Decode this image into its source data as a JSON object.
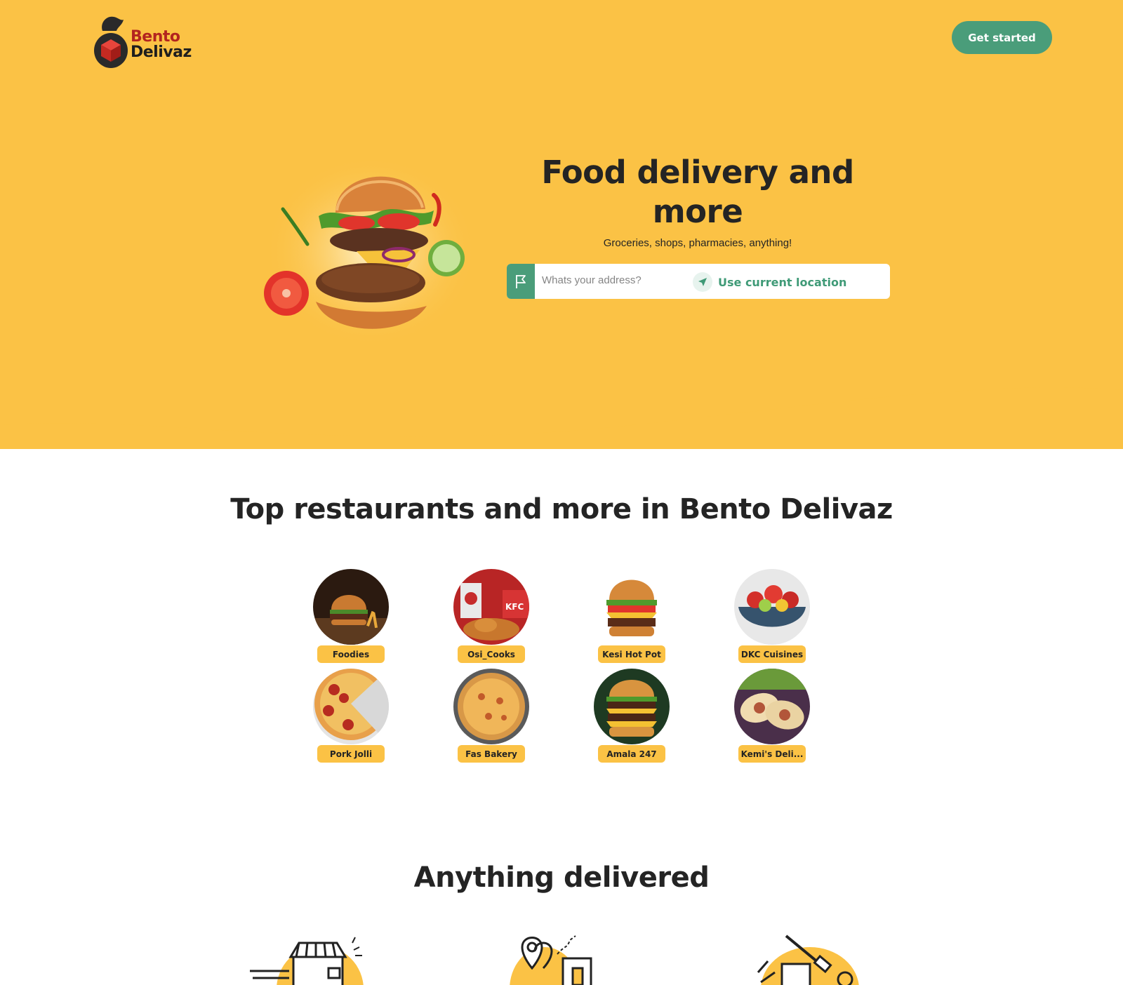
{
  "brand": {
    "name_line1": "Bento",
    "name_line2": "Delivaz",
    "accent_color": "#fbc245",
    "primary_color": "#4a9d7a",
    "brand_red": "#b3241f"
  },
  "header": {
    "cta_label": "Get started"
  },
  "hero": {
    "title": "Food delivery and more",
    "subtitle": "Groceries, shops, pharmacies, anything!",
    "address_placeholder": "Whats your address?",
    "use_location_label": "Use current location"
  },
  "restaurants": {
    "title": "Top restaurants and more in Bento Delivaz",
    "items": [
      {
        "name": "Foodies",
        "image": "burger-with-fries"
      },
      {
        "name": "Osi_Cooks",
        "image": "kfc-chicken"
      },
      {
        "name": "Kesi Hot Pot",
        "image": "cheeseburger"
      },
      {
        "name": "DKC Cuisines",
        "image": "fruit-bowl"
      },
      {
        "name": "Pork Jolli",
        "image": "pepperoni-pizza-slice"
      },
      {
        "name": "Fas Bakery",
        "image": "cheese-pizza"
      },
      {
        "name": "Amala 247",
        "image": "double-burger"
      },
      {
        "name": "Kemi's Deli...",
        "image": "wraps"
      }
    ]
  },
  "categories": {
    "title": "Anything delivered",
    "icons": [
      "shop-icon",
      "map-delivery-icon",
      "pharmacy-icon"
    ]
  }
}
